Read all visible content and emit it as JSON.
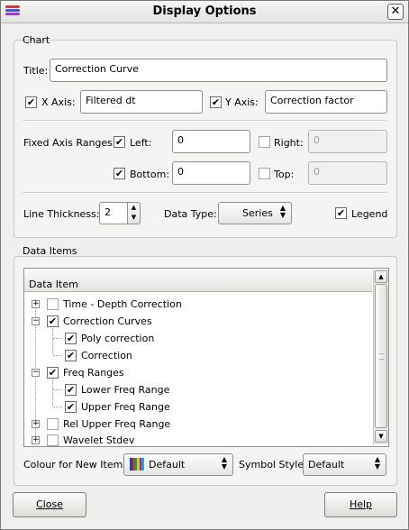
{
  "window": {
    "title": "Display Options",
    "icon": "app-stripes-icon",
    "close_icon": "close-icon"
  },
  "chart_group": {
    "title": "Chart",
    "title_label": "Title:",
    "title_value": "Correction Curve",
    "x_axis": {
      "label": "X Axis:",
      "checked": true,
      "value": "Filtered dt"
    },
    "y_axis": {
      "label": "Y Axis:",
      "checked": true,
      "value": "Correction factor"
    },
    "fixed_ranges_label": "Fixed Axis Ranges",
    "left": {
      "label": "Left:",
      "checked": true,
      "value": "0"
    },
    "right": {
      "label": "Right:",
      "checked": false,
      "value": "0"
    },
    "bottom": {
      "label": "Bottom:",
      "checked": true,
      "value": "0"
    },
    "top": {
      "label": "Top:",
      "checked": false,
      "value": "0"
    },
    "line_thickness": {
      "label": "Line Thickness:",
      "value": "2"
    },
    "data_type": {
      "label": "Data Type:",
      "value": "Series"
    },
    "legend": {
      "label": "Legend",
      "checked": true
    }
  },
  "data_items_group": {
    "title": "Data Items",
    "column_header": "Data Item",
    "items": [
      {
        "label": "Time - Depth Correction",
        "checked": false,
        "level": 0,
        "expander": "+"
      },
      {
        "label": "Correction Curves",
        "checked": true,
        "level": 0,
        "expander": "-"
      },
      {
        "label": "Poly correction",
        "checked": true,
        "level": 1
      },
      {
        "label": "Correction",
        "checked": true,
        "level": 1
      },
      {
        "label": "Freq Ranges",
        "checked": true,
        "level": 0,
        "expander": "-"
      },
      {
        "label": "Lower Freq Range",
        "checked": true,
        "level": 1
      },
      {
        "label": "Upper Freq Range",
        "checked": true,
        "level": 1
      },
      {
        "label": "Rel Upper Freq Range",
        "checked": false,
        "level": 0,
        "expander": "+"
      },
      {
        "label": "Wavelet Stdev",
        "checked": false,
        "level": 0,
        "expander": "+"
      }
    ],
    "colour_label": "Colour for New Items:",
    "colour_value": "Default",
    "swatch_colors": [
      "#1f3fbf",
      "#d42a2a",
      "#2e9a2e",
      "#e3c12a",
      "#8a2bbf",
      "#27a7c9"
    ],
    "symbol_label": "Symbol Style:",
    "symbol_value": "Default"
  },
  "buttons": {
    "close": "Close",
    "help": "Help"
  },
  "colors": {
    "window_bg": "#efefee",
    "check": "#000000"
  }
}
